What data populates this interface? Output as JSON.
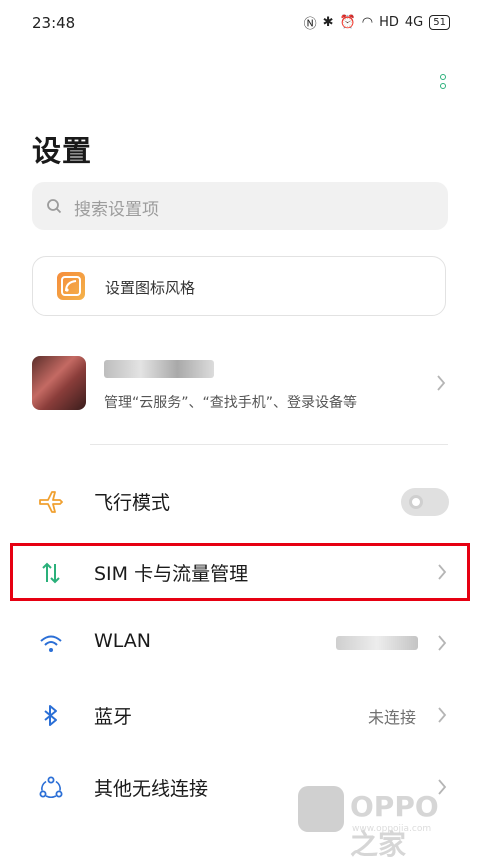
{
  "status_bar": {
    "time": "23:48",
    "network": "HD",
    "signal": "4G",
    "battery": "51"
  },
  "page": {
    "title": "设置"
  },
  "search": {
    "placeholder": "搜索设置项"
  },
  "icon_style": {
    "label": "设置图标风格"
  },
  "account": {
    "subtitle": "管理“云服务”、“查找手机”、登录设备等"
  },
  "rows": [
    {
      "label": "飞行模式",
      "type": "toggle",
      "on": false,
      "icon": "airplane-icon"
    },
    {
      "label": "SIM 卡与流量管理",
      "type": "link",
      "icon": "data-transfer-icon",
      "highlighted": true
    },
    {
      "label": "WLAN",
      "type": "link",
      "icon": "wifi-icon"
    },
    {
      "label": "蓝牙",
      "type": "link",
      "value": "未连接",
      "icon": "bluetooth-icon"
    },
    {
      "label": "其他无线连接",
      "type": "link",
      "icon": "other-wireless-icon"
    }
  ],
  "watermark": {
    "text": "OPPO之家",
    "url": "www.oppojia.com"
  },
  "colors": {
    "accent": "#2ab07a",
    "highlight": "#e60012",
    "airplane": "#f0a030",
    "blue": "#2b6fd6"
  }
}
